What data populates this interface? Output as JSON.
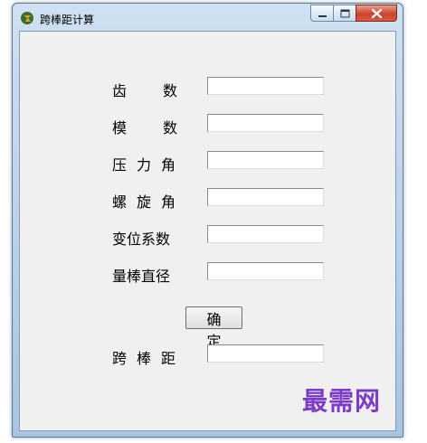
{
  "window": {
    "title": "跨棒距计算"
  },
  "form": {
    "teeth_label": [
      "齿",
      "数"
    ],
    "module_label": [
      "模",
      "数"
    ],
    "pressure_angle_label": [
      "压",
      "力",
      "角"
    ],
    "helix_angle_label": [
      "螺",
      "旋",
      "角"
    ],
    "shift_coefficient_label": "变位系数",
    "pin_diameter_label": "量棒直径",
    "confirm_label": "确 定",
    "span_label": [
      "跨",
      "棒",
      "距"
    ]
  },
  "watermark": "最需网",
  "colors": {
    "window_frame": "#a7c4e2",
    "client_bg": "#f0f0f0",
    "close_button": "#c9452d",
    "watermark": "#7c3cc8"
  }
}
